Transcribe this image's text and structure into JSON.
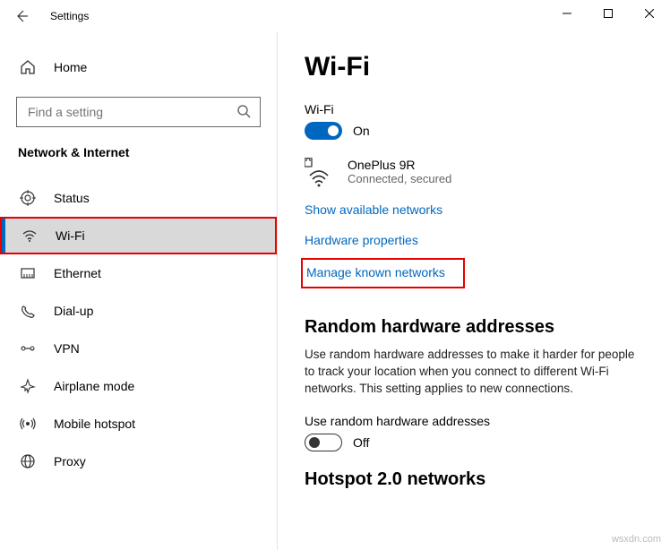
{
  "window": {
    "title": "Settings"
  },
  "sidebar": {
    "home_label": "Home",
    "search_placeholder": "Find a setting",
    "section": "Network & Internet",
    "items": [
      {
        "label": "Status"
      },
      {
        "label": "Wi-Fi"
      },
      {
        "label": "Ethernet"
      },
      {
        "label": "Dial-up"
      },
      {
        "label": "VPN"
      },
      {
        "label": "Airplane mode"
      },
      {
        "label": "Mobile hotspot"
      },
      {
        "label": "Proxy"
      }
    ]
  },
  "main": {
    "heading": "Wi-Fi",
    "wifi_label": "Wi-Fi",
    "wifi_toggle_state": "On",
    "network": {
      "name": "OnePlus 9R",
      "status": "Connected, secured"
    },
    "links": {
      "show_available": "Show available networks",
      "hardware_props": "Hardware properties",
      "manage_known": "Manage known networks"
    },
    "random_hw": {
      "heading": "Random hardware addresses",
      "body": "Use random hardware addresses to make it harder for people to track your location when you connect to different Wi-Fi networks. This setting applies to new connections.",
      "toggle_label": "Use random hardware addresses",
      "toggle_state": "Off"
    },
    "hotspot_heading": "Hotspot 2.0 networks"
  },
  "watermark": "wsxdn.com"
}
